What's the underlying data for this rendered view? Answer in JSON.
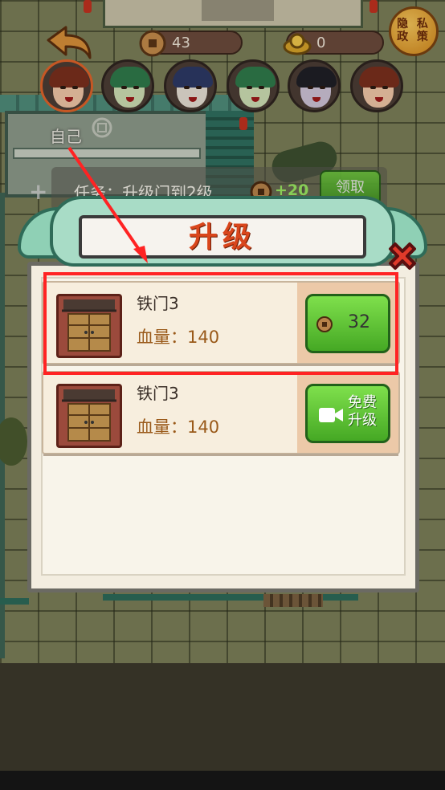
{
  "hud": {
    "coins": "43",
    "gems": "0",
    "privacy_label": "隐私政策",
    "privacy_line1": "隐 私",
    "privacy_line2": "政 策"
  },
  "avatars": [
    {
      "name": "self-girl",
      "hair": "#7a2f1d",
      "face": "#f2c8a8"
    },
    {
      "name": "green-opera",
      "hair": "#2f7a4b",
      "face": "#cfe0b4"
    },
    {
      "name": "moon-lady",
      "hair": "#2d3a66",
      "face": "#e6e0d4"
    },
    {
      "name": "green-opera-2",
      "hair": "#2f7a4b",
      "face": "#cfe0b4"
    },
    {
      "name": "ghost-lady",
      "hair": "#1f1f26",
      "face": "#cfc4d8"
    },
    {
      "name": "red-girl",
      "hair": "#7a2f1d",
      "face": "#f2c8a8"
    }
  ],
  "self_label": "自己",
  "task": {
    "text": "任务：升级门到2级",
    "reward": "+20",
    "claim": "领取"
  },
  "panel": {
    "title": "升级",
    "rows": [
      {
        "name": "铁门3",
        "hp": "血量：140",
        "action": "cost",
        "cost": "32"
      },
      {
        "name": "铁门3",
        "hp": "血量：140",
        "action": "video",
        "free_line1": "免费",
        "free_line2": "升级"
      }
    ]
  },
  "colors": {
    "highlight": "#ff2323",
    "accent_green": "#45a824",
    "title_red": "#d9461c"
  }
}
